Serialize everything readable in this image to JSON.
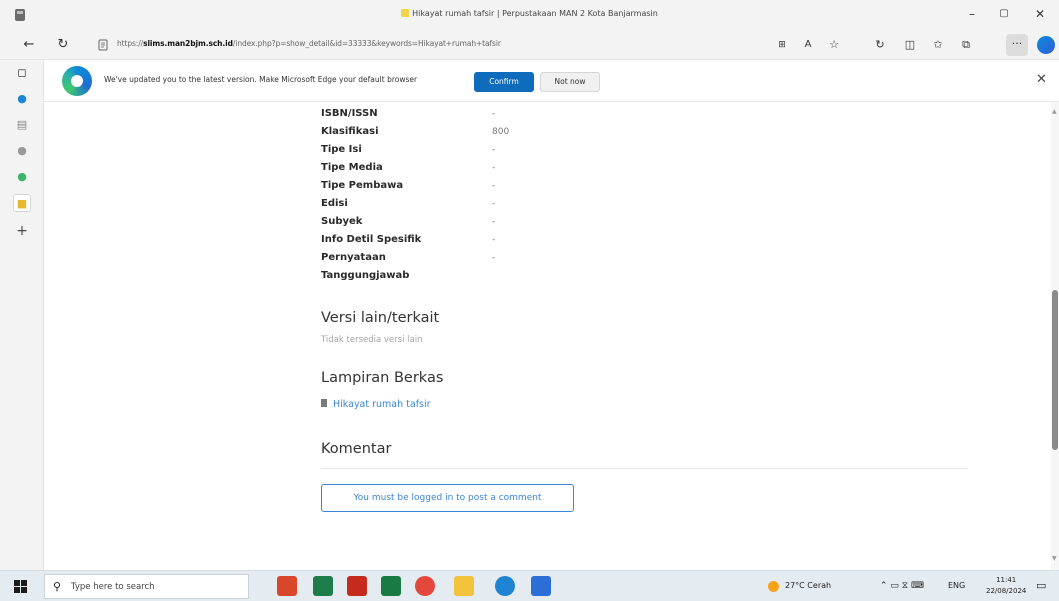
{
  "titlebar": {
    "title": "Hikayat rumah tafsir | Perpustakaan MAN 2 Kota Banjarmasin",
    "minimize": "–",
    "maximize": "▢",
    "close": "✕"
  },
  "address": {
    "url_prefix": "https://",
    "url_domain": "slims.man2bjm.sch.id",
    "url_rest": "/index.php?p=show_detail&id=33333&keywords=Hikayat+rumah+tafsir",
    "reader_icon": "A",
    "more_label": "···"
  },
  "banner": {
    "message": "We've updated you to the latest version. Make Microsoft Edge your default browser",
    "confirm": "Confirm",
    "not_now": "Not now",
    "close": "✕"
  },
  "details": [
    {
      "label": "ISBN/ISSN",
      "value": "-"
    },
    {
      "label": "Klasifikasi",
      "value": "800"
    },
    {
      "label": "Tipe Isi",
      "value": "-"
    },
    {
      "label": "Tipe Media",
      "value": "-"
    },
    {
      "label": "Tipe Pembawa",
      "value": "-"
    },
    {
      "label": "Edisi",
      "value": "-"
    },
    {
      "label": "Subyek",
      "value": "-"
    },
    {
      "label": "Info Detil Spesifik",
      "value": "-"
    },
    {
      "label": "Pernyataan",
      "value": "-"
    },
    {
      "label": "Tanggungjawab",
      "value": ""
    }
  ],
  "versions": {
    "title": "Versi lain/terkait",
    "empty": "Tidak tersedia versi lain"
  },
  "attachments": {
    "title": "Lampiran Berkas",
    "file": "Hikayat rumah tafsir"
  },
  "comments": {
    "title": "Komentar",
    "login_prompt": "You must be logged in to post a comment"
  },
  "taskbar": {
    "search_placeholder": "Type here to search",
    "weather": "27°C Cerah",
    "language": "ENG",
    "time": "11:41",
    "date": "22/08/2024"
  }
}
